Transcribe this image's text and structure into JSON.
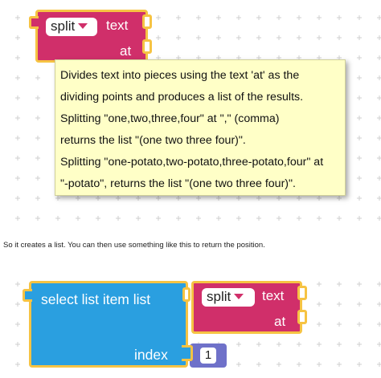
{
  "split_block_top": {
    "dropdown_value": "split",
    "label_text": "text",
    "label_at": "at"
  },
  "tooltip": {
    "lines": [
      "Divides text into pieces using the text 'at' as the",
      "dividing points and produces a list of the results.",
      "Splitting \"one,two,three,four\" at \",\" (comma)",
      "returns the list \"(one two three four)\".",
      "Splitting \"one-potato,two-potato,three-potato,four\" at",
      "\"-potato\", returns the list \"(one two three four)\"."
    ]
  },
  "prose": "So it creates a list. You can then use something like this to return the position.",
  "select_block": {
    "label_main": "select list item  list",
    "label_index": "index",
    "index_value": "1"
  },
  "split_block_bottom": {
    "dropdown_value": "split",
    "label_text": "text",
    "label_at": "at"
  },
  "colors": {
    "text_block": "#d02f6a",
    "list_block": "#2a9fe0",
    "highlight": "#f6c343",
    "tooltip_bg": "#ffffc7",
    "math_block": "#6f71c9"
  }
}
